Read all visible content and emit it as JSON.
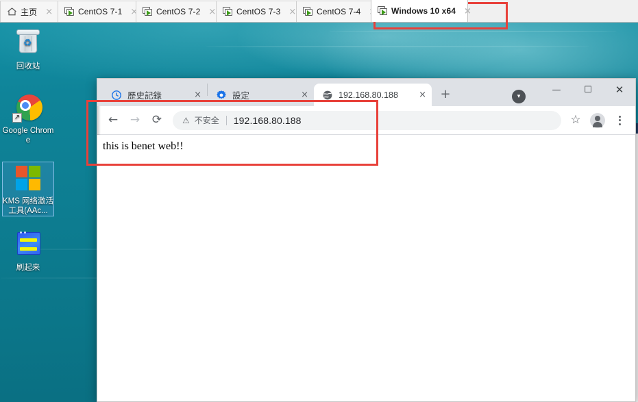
{
  "vmware": {
    "tabs": [
      {
        "label": "主页",
        "icon": "home-icon",
        "active": false,
        "close": "×"
      },
      {
        "label": "CentOS 7-1",
        "icon": "vm-icon",
        "active": false,
        "close": "×"
      },
      {
        "label": "CentOS 7-2",
        "icon": "vm-icon",
        "active": false,
        "close": "×"
      },
      {
        "label": "CentOS 7-3",
        "icon": "vm-icon",
        "active": false,
        "close": "×"
      },
      {
        "label": "CentOS 7-4",
        "icon": "vm-icon",
        "active": false,
        "close": "×"
      },
      {
        "label": "Windows 10 x64",
        "icon": "vm-icon",
        "active": true,
        "close": "×"
      }
    ]
  },
  "desktop": {
    "icons": [
      {
        "name": "recycle-bin",
        "label": "回收站",
        "selected": false
      },
      {
        "name": "google-chrome",
        "label": "Google Chrome",
        "selected": false
      },
      {
        "name": "kms-tool",
        "label": "KMS 网络激活工具(AAc...",
        "selected": true
      },
      {
        "name": "shuaiqilai",
        "label": "刷起来",
        "selected": false
      }
    ],
    "wallpaper_color": "#0d7e92"
  },
  "browser": {
    "tabs": [
      {
        "label": "歷史記錄",
        "icon": "history-icon",
        "active": false,
        "close": "×"
      },
      {
        "label": "設定",
        "icon": "settings-gear-icon",
        "active": false,
        "close": "×"
      },
      {
        "label": "192.168.80.188",
        "icon": "globe-icon",
        "active": true,
        "close": "×"
      }
    ],
    "new_tab_label": "+",
    "update_badge": "▾",
    "window_controls": {
      "minimize": "—",
      "maximize": "☐",
      "close": "✕"
    },
    "toolbar": {
      "back": "←",
      "forward": "→",
      "reload": "⟳",
      "security_icon": "⚠",
      "security_text": "不安全",
      "url": "192.168.80.188",
      "bookmark": "☆",
      "profile": "avatar-icon",
      "menu": "⋮"
    },
    "page": {
      "body_text": "this is benet web!!"
    }
  },
  "annotations": {
    "accent_color": "#e8413a",
    "boxes": [
      {
        "name": "windows-10-tab-highlight"
      },
      {
        "name": "address-bar-and-page-highlight"
      }
    ]
  }
}
